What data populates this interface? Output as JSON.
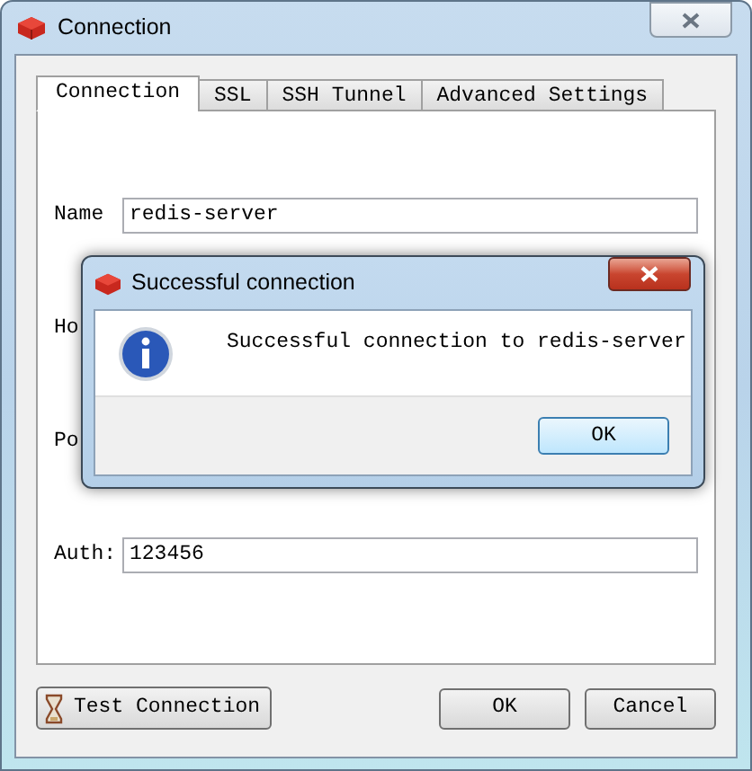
{
  "window": {
    "title": "Connection"
  },
  "tabs": [
    {
      "label": "Connection",
      "selected": true
    },
    {
      "label": "SSL",
      "selected": false
    },
    {
      "label": "SSH Tunnel",
      "selected": false
    },
    {
      "label": "Advanced Settings",
      "selected": false
    }
  ],
  "fields": [
    {
      "label": "Name",
      "value": "redis-server"
    },
    {
      "label": "Ho"
    },
    {
      "label": "Po"
    },
    {
      "label": "Auth:",
      "value": "123456"
    }
  ],
  "buttons": {
    "test": "Test Connection",
    "ok": "OK",
    "cancel": "Cancel"
  },
  "dialog": {
    "title": "Successful connection",
    "message": "Successful connection to redis-server",
    "button": "OK"
  }
}
